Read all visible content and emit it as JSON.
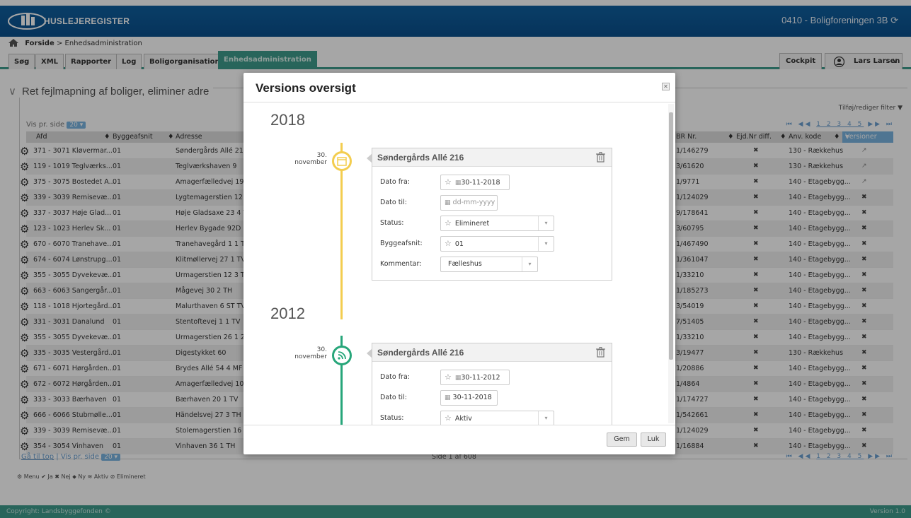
{
  "app": {
    "brand": "HUSLEJEREGISTER",
    "org": "0410 - Boligforeningen 3B"
  },
  "breadcrumb": {
    "home": "Forside",
    "sep": ">",
    "current": "Enhedsadministration"
  },
  "nav": {
    "tabs": [
      "Søg",
      "XML",
      "Rapporter",
      "Log",
      "Boligorganisation",
      "Enhedsadministration"
    ],
    "cockpit": "Cockpit",
    "user": "Lars Larsen"
  },
  "section": {
    "title": "Ret fejlmapning af boliger, eliminer adre",
    "filter_label": "Tilføj/rediger filter",
    "vis_pr_side": "Vis pr. side",
    "page_size": "20",
    "pager": "1 2 3 4 5"
  },
  "table": {
    "headers": {
      "afd": "Afd",
      "bygge": "Byggeafsnit",
      "adresse": "Adresse",
      "br": "BR Nr.",
      "ejd": "Ejd.Nr diff.",
      "anv": "Anv. kode",
      "versioner": "Versioner"
    },
    "rows": [
      {
        "afd": "371 - 3071 Kløvermar...",
        "bygge": "01",
        "adresse": "Søndergårds Allé 216",
        "br": "1/146279",
        "ejd": "✖",
        "anv": "130 - Rækkehus",
        "ver": "↗"
      },
      {
        "afd": "119 - 1019 Teglværks...",
        "bygge": "01",
        "adresse": "Teglværkshaven 9",
        "br": "3/61620",
        "ejd": "✖",
        "anv": "130 - Rækkehus",
        "ver": "↗"
      },
      {
        "afd": "375 - 3075 Bostedet A...",
        "bygge": "01",
        "adresse": "Amagerfælledvej 199",
        "br": "1/9771",
        "ejd": "✖",
        "anv": "140 - Etagebygg...",
        "ver": "↗"
      },
      {
        "afd": "339 - 3039 Remisevæ...",
        "bygge": "01",
        "adresse": "Lygtemagerstien 12 4",
        "br": "1/124029",
        "ejd": "✖",
        "anv": "140 - Etagebygg...",
        "ver": "✖"
      },
      {
        "afd": "337 - 3037 Høje Glad...",
        "bygge": "01",
        "adresse": "Høje Gladsaxe 23 4 T",
        "br": "9/178641",
        "ejd": "✖",
        "anv": "140 - Etagebygg...",
        "ver": "✖"
      },
      {
        "afd": "123 - 1023 Herlev Sk...",
        "bygge": "01",
        "adresse": "Herlev Bygade 92D S",
        "br": "3/60795",
        "ejd": "✖",
        "anv": "140 - Etagebygg...",
        "ver": "✖"
      },
      {
        "afd": "670 - 6070 Tranehave...",
        "bygge": "01",
        "adresse": "Tranehavegård 1 1 TV",
        "br": "1/467490",
        "ejd": "✖",
        "anv": "140 - Etagebygg...",
        "ver": "✖"
      },
      {
        "afd": "674 - 6074 Lønstrupg...",
        "bygge": "01",
        "adresse": "Klitmøllervej 27 1 TV",
        "br": "1/361047",
        "ejd": "✖",
        "anv": "140 - Etagebygg...",
        "ver": "✖"
      },
      {
        "afd": "355 - 3055 Dyvekevæ...",
        "bygge": "01",
        "adresse": "Urmagerstien 12 3 TH",
        "br": "1/33210",
        "ejd": "✖",
        "anv": "140 - Etagebygg...",
        "ver": "✖"
      },
      {
        "afd": "663 - 6063 Sangergår...",
        "bygge": "01",
        "adresse": "Mågevej 30 2 TH",
        "br": "1/185273",
        "ejd": "✖",
        "anv": "140 - Etagebygg...",
        "ver": "✖"
      },
      {
        "afd": "118 - 1018 Hjortegård...",
        "bygge": "01",
        "adresse": "Malurthaven 6 ST TV",
        "br": "3/54019",
        "ejd": "✖",
        "anv": "140 - Etagebygg...",
        "ver": "✖"
      },
      {
        "afd": "331 - 3031 Danalund",
        "bygge": "01",
        "adresse": "Stentoftevej 1 1 TV",
        "br": "7/51405",
        "ejd": "✖",
        "anv": "140 - Etagebygg...",
        "ver": "✖"
      },
      {
        "afd": "355 - 3055 Dyvekevæ...",
        "bygge": "01",
        "adresse": "Urmagerstien 26 1 2",
        "br": "1/33210",
        "ejd": "✖",
        "anv": "140 - Etagebygg...",
        "ver": "✖"
      },
      {
        "afd": "335 - 3035 Vestergård...",
        "bygge": "01",
        "adresse": "Digestykket 60",
        "br": "3/19477",
        "ejd": "✖",
        "anv": "130 - Rækkehus",
        "ver": "✖"
      },
      {
        "afd": "671 - 6071 Hørgården...",
        "bygge": "01",
        "adresse": "Brydes Allé 54 4 MF",
        "br": "1/20886",
        "ejd": "✖",
        "anv": "140 - Etagebygg...",
        "ver": "✖"
      },
      {
        "afd": "672 - 6072 Hørgården...",
        "bygge": "01",
        "adresse": "Amagerfælledvej 103",
        "br": "1/4864",
        "ejd": "✖",
        "anv": "140 - Etagebygg...",
        "ver": "✖"
      },
      {
        "afd": "333 - 3033 Bærhaven",
        "bygge": "01",
        "adresse": "Bærhaven 20 1 TV",
        "br": "1/174727",
        "ejd": "✖",
        "anv": "140 - Etagebygg...",
        "ver": "✖"
      },
      {
        "afd": "666 - 6066 Stubmølle...",
        "bygge": "01",
        "adresse": "Händelsvej 27 3 TH",
        "br": "1/542661",
        "ejd": "✖",
        "anv": "140 - Etagebygg...",
        "ver": "✖"
      },
      {
        "afd": "339 - 3039 Remisevæ...",
        "bygge": "01",
        "adresse": "Stolemagerstien 16 3",
        "br": "1/124029",
        "ejd": "✖",
        "anv": "140 - Etagebygg...",
        "ver": "✖"
      },
      {
        "afd": "354 - 3054 Vinhaven",
        "bygge": "01",
        "adresse": "Vinhaven 36 1 TH",
        "br": "1/16884",
        "ejd": "✖",
        "anv": "140 - Etagebygg...",
        "ver": "✖"
      }
    ]
  },
  "bottom": {
    "goto_top": "Gå til top",
    "sep": " | ",
    "vis_pr_side": "Vis pr. side",
    "page_size": "20",
    "page_info": "Side 1 af 608",
    "pager": "1 2 3 4 5"
  },
  "legend": {
    "menu": "Menu",
    "ja": "Ja",
    "nej": "Nej",
    "ny": "Ny",
    "aktiv": "Aktiv",
    "elimineret": "Elimineret"
  },
  "footer": {
    "copyright": "Copyright: Landsbyggefonden ©",
    "version": "Version 1.0"
  },
  "modal": {
    "title": "Versions oversigt",
    "gem": "Gem",
    "luk": "Luk",
    "versions": [
      {
        "year": "2018",
        "day": "30.",
        "month": "november",
        "address": "Søndergårds Allé 216",
        "labels": {
          "fra": "Dato fra:",
          "til": "Dato til:",
          "status": "Status:",
          "bygge": "Byggeafsnit:",
          "kommentar": "Kommentar:"
        },
        "dato_fra": "30-11-2018",
        "dato_til_placeholder": "dd-mm-yyyy",
        "status": "Elimineret",
        "byggeafsnit": "01",
        "kommentar": "Fælleshus",
        "color": "#f3cd4f"
      },
      {
        "year": "2012",
        "day": "30.",
        "month": "november",
        "address": "Søndergårds Allé 216",
        "labels": {
          "fra": "Dato fra:",
          "til": "Dato til:",
          "status": "Status:"
        },
        "dato_fra": "30-11-2012",
        "dato_til": "30-11-2018",
        "status": "Aktiv",
        "color": "#27a67a"
      }
    ]
  }
}
